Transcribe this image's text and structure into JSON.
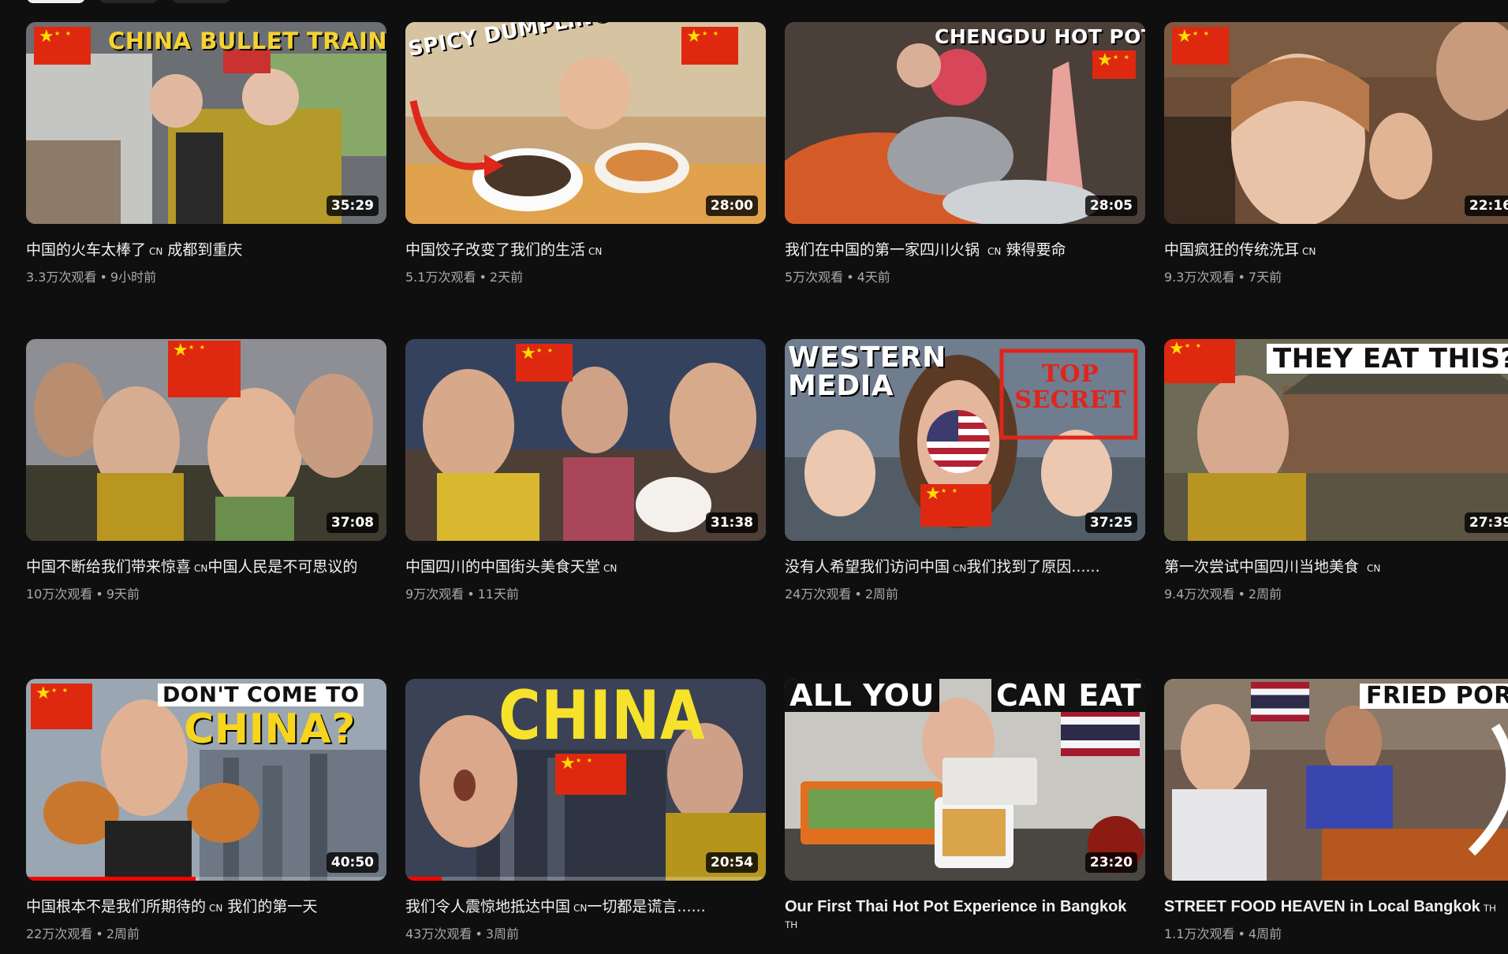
{
  "colors": {
    "background": "#0f0f0f",
    "progress": "#ff0000",
    "meta_text": "#aaaaaa"
  },
  "videos": [
    {
      "thumb_text": [
        "CHINA BULLET TRAIN"
      ],
      "duration": "35:29",
      "title": "中国的火车太棒了",
      "tag": "CN",
      "title_suffix": " 成都到重庆",
      "views": "3.3万次观看",
      "age": "9小时前"
    },
    {
      "thumb_text": [
        "SPICY DUMPLINGS"
      ],
      "duration": "28:00",
      "title": "中国饺子改变了我们的生活",
      "tag": "CN",
      "title_suffix": "",
      "views": "5.1万次观看",
      "age": "2天前"
    },
    {
      "thumb_text": [
        "CHENGDU HOT POT"
      ],
      "duration": "28:05",
      "title": "我们在中国的第一家四川火锅 ",
      "tag": "CN",
      "title_suffix": " 辣得要命",
      "views": "5万次观看",
      "age": "4天前"
    },
    {
      "thumb_text": [],
      "duration": "22:16",
      "title": "中国疯狂的传统洗耳",
      "tag": "CN",
      "title_suffix": "",
      "views": "9.3万次观看",
      "age": "7天前"
    },
    {
      "thumb_text": [],
      "duration": "37:08",
      "title": "中国不断给我们带来惊喜",
      "tag": "CN",
      "title_suffix": "中国人民是不可思议的",
      "views": "10万次观看",
      "age": "9天前"
    },
    {
      "thumb_text": [],
      "duration": "31:38",
      "title": "中国四川的中国街头美食天堂",
      "tag": "CN",
      "title_suffix": "",
      "views": "9万次观看",
      "age": "11天前"
    },
    {
      "thumb_text": [
        "WESTERN",
        "MEDIA",
        "TOP SECRET"
      ],
      "duration": "37:25",
      "title": "没有人希望我们访问中国",
      "tag": "CN",
      "title_suffix": "我们找到了原因......",
      "views": "24万次观看",
      "age": "2周前"
    },
    {
      "thumb_text": [
        "THEY EAT THIS?"
      ],
      "duration": "27:39",
      "title": "第一次尝试中国四川当地美食 ",
      "tag": "CN",
      "title_suffix": "",
      "views": "9.4万次观看",
      "age": "2周前"
    },
    {
      "thumb_text": [
        "DON'T COME TO",
        "CHINA?"
      ],
      "duration": "40:50",
      "progress": 0.47,
      "title": "中国根本不是我们所期待的",
      "tag": "CN",
      "title_suffix": " 我们的第一天",
      "views": "22万次观看",
      "age": "2周前"
    },
    {
      "thumb_text": [
        "CHINA"
      ],
      "duration": "20:54",
      "progress": 0.1,
      "title": "我们令人震惊地抵达中国",
      "tag": "CN",
      "title_suffix": "一切都是谎言......",
      "views": "43万次观看",
      "age": "3周前"
    },
    {
      "thumb_text": [
        "ALL YOU",
        "CAN EAT"
      ],
      "duration": "23:20",
      "title": "Our First Thai Hot Pot Experience in Bangkok",
      "tag": "TH",
      "title_suffix": "",
      "views": "",
      "age": ""
    },
    {
      "thumb_text": [
        "FRIED PORK"
      ],
      "duration": "",
      "title": "STREET FOOD HEAVEN in Local Bangkok",
      "tag": "TH",
      "title_suffix": "",
      "views": "1.1万次观看",
      "age": "4周前"
    }
  ]
}
